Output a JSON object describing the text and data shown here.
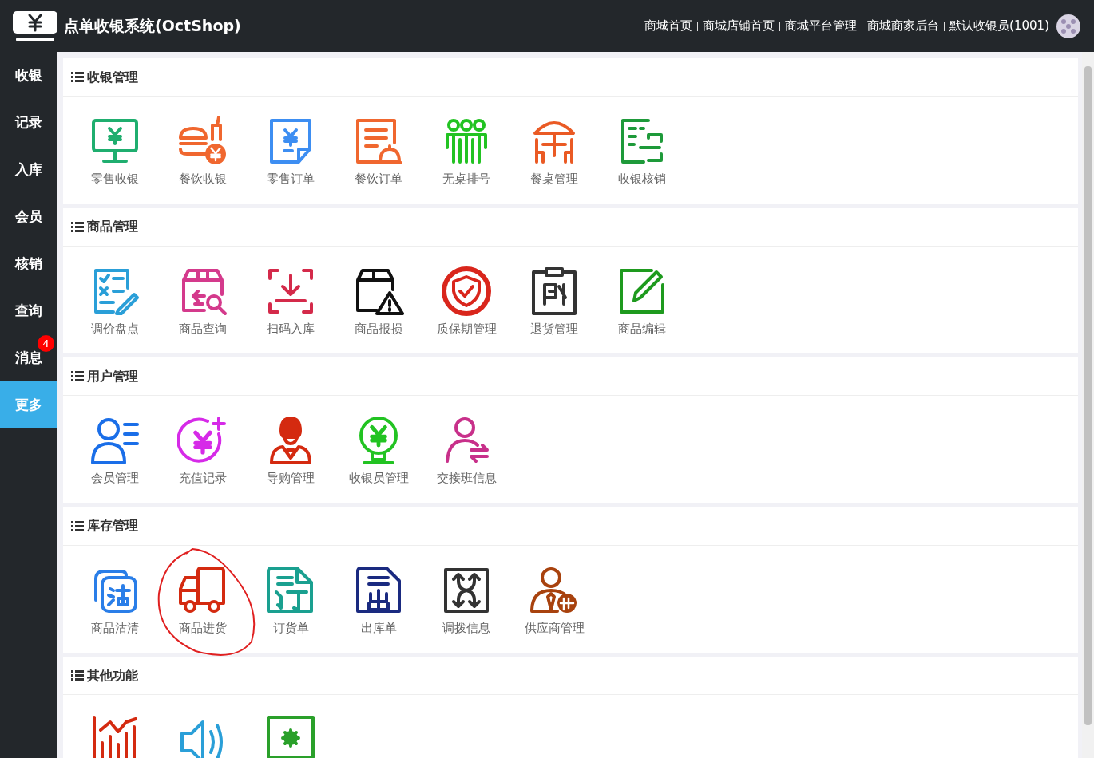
{
  "header": {
    "title": "点单收银系统(OctShop)",
    "links": [
      "商城首页",
      "商城店铺首页",
      "商城平台管理",
      "商城商家后台",
      "默认收银员(1001)"
    ]
  },
  "sidebar": {
    "items": [
      {
        "label": "收银",
        "selected": false
      },
      {
        "label": "记录",
        "selected": false
      },
      {
        "label": "入库",
        "selected": false
      },
      {
        "label": "会员",
        "selected": false
      },
      {
        "label": "核销",
        "selected": false
      },
      {
        "label": "查询",
        "selected": false
      },
      {
        "label": "消息",
        "selected": false,
        "badge": "4"
      },
      {
        "label": "更多",
        "selected": true
      }
    ]
  },
  "sections": [
    {
      "title": "收银管理",
      "items": [
        {
          "kind": "tile",
          "label": "零售收银",
          "circled": false
        },
        {
          "kind": "tile",
          "label": "餐饮收银",
          "circled": false
        },
        {
          "kind": "tile",
          "label": "零售订单",
          "circled": false
        },
        {
          "kind": "tile",
          "label": "餐饮订单",
          "circled": false
        },
        {
          "kind": "tile",
          "label": "无桌排号",
          "circled": false
        },
        {
          "kind": "tile",
          "label": "餐桌管理",
          "circled": false
        },
        {
          "kind": "tile",
          "label": "收银核销",
          "circled": false
        }
      ]
    },
    {
      "title": "商品管理",
      "items": [
        {
          "kind": "tile",
          "label": "调价盘点",
          "circled": false
        },
        {
          "kind": "tile",
          "label": "商品查询",
          "circled": false
        },
        {
          "kind": "tile",
          "label": "扫码入库",
          "circled": false
        },
        {
          "kind": "tile",
          "label": "商品报损",
          "circled": false
        },
        {
          "kind": "tile",
          "label": "质保期管理",
          "circled": false
        },
        {
          "kind": "tile",
          "label": "退货管理",
          "circled": false
        },
        {
          "kind": "tile",
          "label": "商品编辑",
          "circled": false
        }
      ]
    },
    {
      "title": "用户管理",
      "items": [
        {
          "kind": "tile",
          "label": "会员管理",
          "circled": false
        },
        {
          "kind": "tile",
          "label": "充值记录",
          "circled": false
        },
        {
          "kind": "tile",
          "label": "导购管理",
          "circled": false
        },
        {
          "kind": "tile",
          "label": "收银员管理",
          "circled": false
        },
        {
          "kind": "tile",
          "label": "交接班信息",
          "circled": false
        }
      ]
    },
    {
      "title": "库存管理",
      "items": [
        {
          "kind": "tile",
          "label": "商品沽清",
          "circled": false
        },
        {
          "kind": "tile",
          "label": "商品进货",
          "circled": true
        },
        {
          "kind": "tile",
          "label": "订货单",
          "circled": false
        },
        {
          "kind": "tile",
          "label": "出库单",
          "circled": false
        },
        {
          "kind": "tile",
          "label": "调拨信息",
          "circled": false
        },
        {
          "kind": "tile",
          "label": "供应商管理",
          "circled": false
        }
      ]
    },
    {
      "title": "其他功能",
      "items": [
        {
          "kind": "icon_only"
        },
        {
          "kind": "icon_only"
        },
        {
          "kind": "icon_only"
        }
      ]
    }
  ]
}
